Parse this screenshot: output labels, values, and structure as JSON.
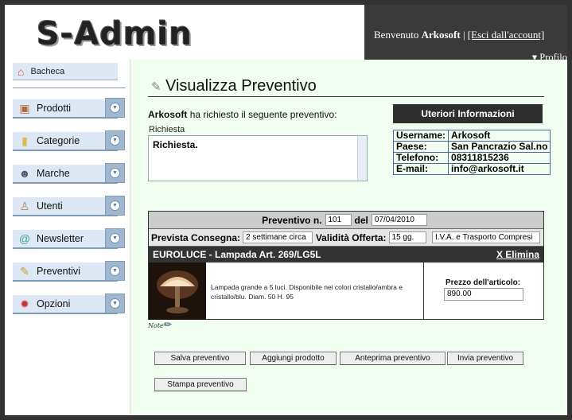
{
  "header": {
    "logo_text": "S-Admin",
    "welcome_prefix": "Benvenuto",
    "username": "Arkosoft",
    "separator": "|",
    "logout_label": "[Esci dall'account]",
    "profile_label": "▾ Profilo"
  },
  "sidebar": {
    "dashboard": {
      "label": "Bacheca",
      "icon": "home-icon"
    },
    "items": [
      {
        "label": "Prodotti",
        "icon": "box-icon"
      },
      {
        "label": "Categorie",
        "icon": "folder-icon"
      },
      {
        "label": "Marche",
        "icon": "users-icon"
      },
      {
        "label": "Utenti",
        "icon": "user-icon"
      },
      {
        "label": "Newsletter",
        "icon": "mail-icon"
      },
      {
        "label": "Preventivi",
        "icon": "document-icon"
      },
      {
        "label": "Opzioni",
        "icon": "gear-icon"
      }
    ]
  },
  "main": {
    "title": "Visualizza Preventivo",
    "requester": "Arkosoft",
    "request_text": "ha richiesto il seguente preventivo:",
    "request_label": "Richiesta",
    "request_value": "Richiesta.",
    "info": {
      "header": "Uteriori Informazioni",
      "rows": [
        {
          "key": "Username:",
          "value": "Arkosoft"
        },
        {
          "key": "Paese:",
          "value": "San Pancrazio Sal.no"
        },
        {
          "key": "Telefono:",
          "value": "08311815236"
        },
        {
          "key": "E-mail:",
          "value": "info@arkosoft.it"
        }
      ]
    },
    "quote": {
      "number_label": "Preventivo n.",
      "number_value": "101",
      "date_label": "del",
      "date_value": "07/04/2010",
      "delivery_label": "Prevista Consegna:",
      "delivery_value": "2 settimane circa",
      "validity_label": "Validità Offerta:",
      "validity_value": "15 gg.",
      "vat_value": "I.V.A. e Trasporto Compresi",
      "product_title": "EUROLUCE - Lampada Art. 269/LG5L",
      "delete_label": "X Elimina",
      "product_description": "Lampada grande a 5 luci. Disponibile nei colori cristallo/ambra e cristallo/blu. Diam. 50 H. 95",
      "price_label": "Prezzo dell'articolo:",
      "price_value": "890.00"
    },
    "note_label": "Note",
    "buttons": {
      "save": "Salva preventivo",
      "add": "Aggiungi prodotto",
      "preview": "Anteprima preventivo",
      "send": "Invia preventivo",
      "print": "Stampa preventivo"
    }
  }
}
